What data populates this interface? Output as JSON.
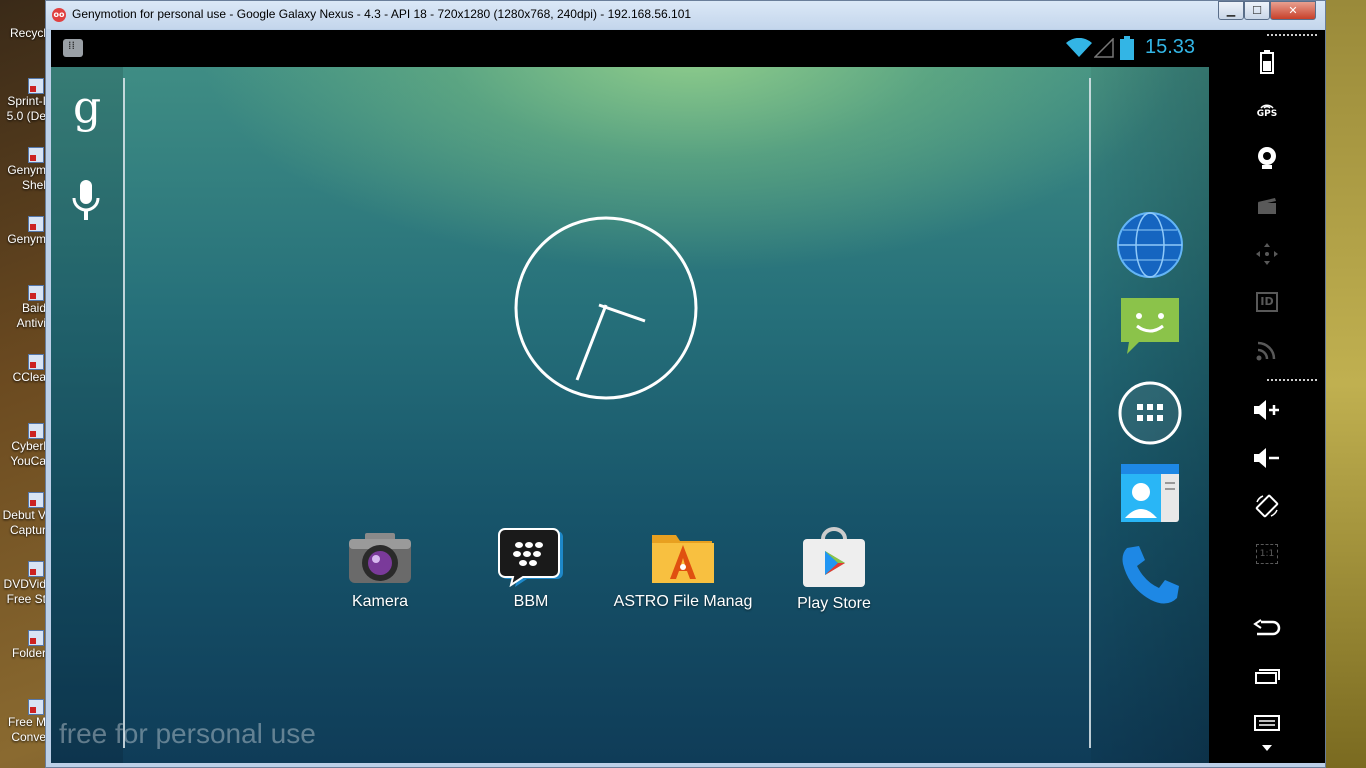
{
  "window": {
    "title": "Genymotion for personal use - Google Galaxy Nexus - 4.3 - API 18 - 720x1280 (1280x768, 240dpi) - 192.168.56.101",
    "icon_label": "oo",
    "buttons": {
      "minimize": "▁",
      "maximize": "☐",
      "close": "✕"
    }
  },
  "desktop": {
    "icons": [
      {
        "label": "Recycl"
      },
      {
        "label": "Sprint-I 5.0 (De"
      },
      {
        "label": "Genym Shel"
      },
      {
        "label": "Genym"
      },
      {
        "label": "Baid Antivi"
      },
      {
        "label": "CClea"
      },
      {
        "label": "Cyberl YouCa"
      },
      {
        "label": "Debut V Captur"
      },
      {
        "label": "DVDVid Free St"
      },
      {
        "label": "Folder"
      },
      {
        "label": "Free M Conve"
      }
    ]
  },
  "status_bar": {
    "time": "15.33",
    "icons": [
      "bbm-notification-icon",
      "wifi-icon",
      "signal-icon",
      "battery-icon"
    ],
    "accent_color": "#33b5e5"
  },
  "home": {
    "search_letter": "g",
    "apps": [
      {
        "label": "Kamera",
        "icon": "camera-icon"
      },
      {
        "label": "BBM",
        "icon": "bbm-icon"
      },
      {
        "label": "ASTRO File Manag",
        "icon": "astro-file-manager-icon"
      },
      {
        "label": "Play Store",
        "icon": "play-store-icon"
      }
    ],
    "dock": [
      "browser-globe-icon",
      "messaging-icon",
      "app-drawer-icon",
      "contacts-icon",
      "phone-icon"
    ],
    "watermark": "free for personal use"
  },
  "controls": {
    "items": [
      {
        "name": "battery-control",
        "label": ""
      },
      {
        "name": "gps-control",
        "label": "GPS"
      },
      {
        "name": "camera-control",
        "label": ""
      },
      {
        "name": "screencast-control",
        "label": ""
      },
      {
        "name": "dpad-control",
        "label": ""
      },
      {
        "name": "device-id-control",
        "label": "ID"
      },
      {
        "name": "network-control",
        "label": ""
      },
      {
        "name": "volume-up-control",
        "label": ""
      },
      {
        "name": "volume-down-control",
        "label": ""
      },
      {
        "name": "rotate-control",
        "label": ""
      },
      {
        "name": "pixel-perfect-control",
        "label": "1:1"
      },
      {
        "name": "back-control",
        "label": ""
      },
      {
        "name": "recent-apps-control",
        "label": ""
      },
      {
        "name": "menu-control",
        "label": ""
      }
    ]
  }
}
